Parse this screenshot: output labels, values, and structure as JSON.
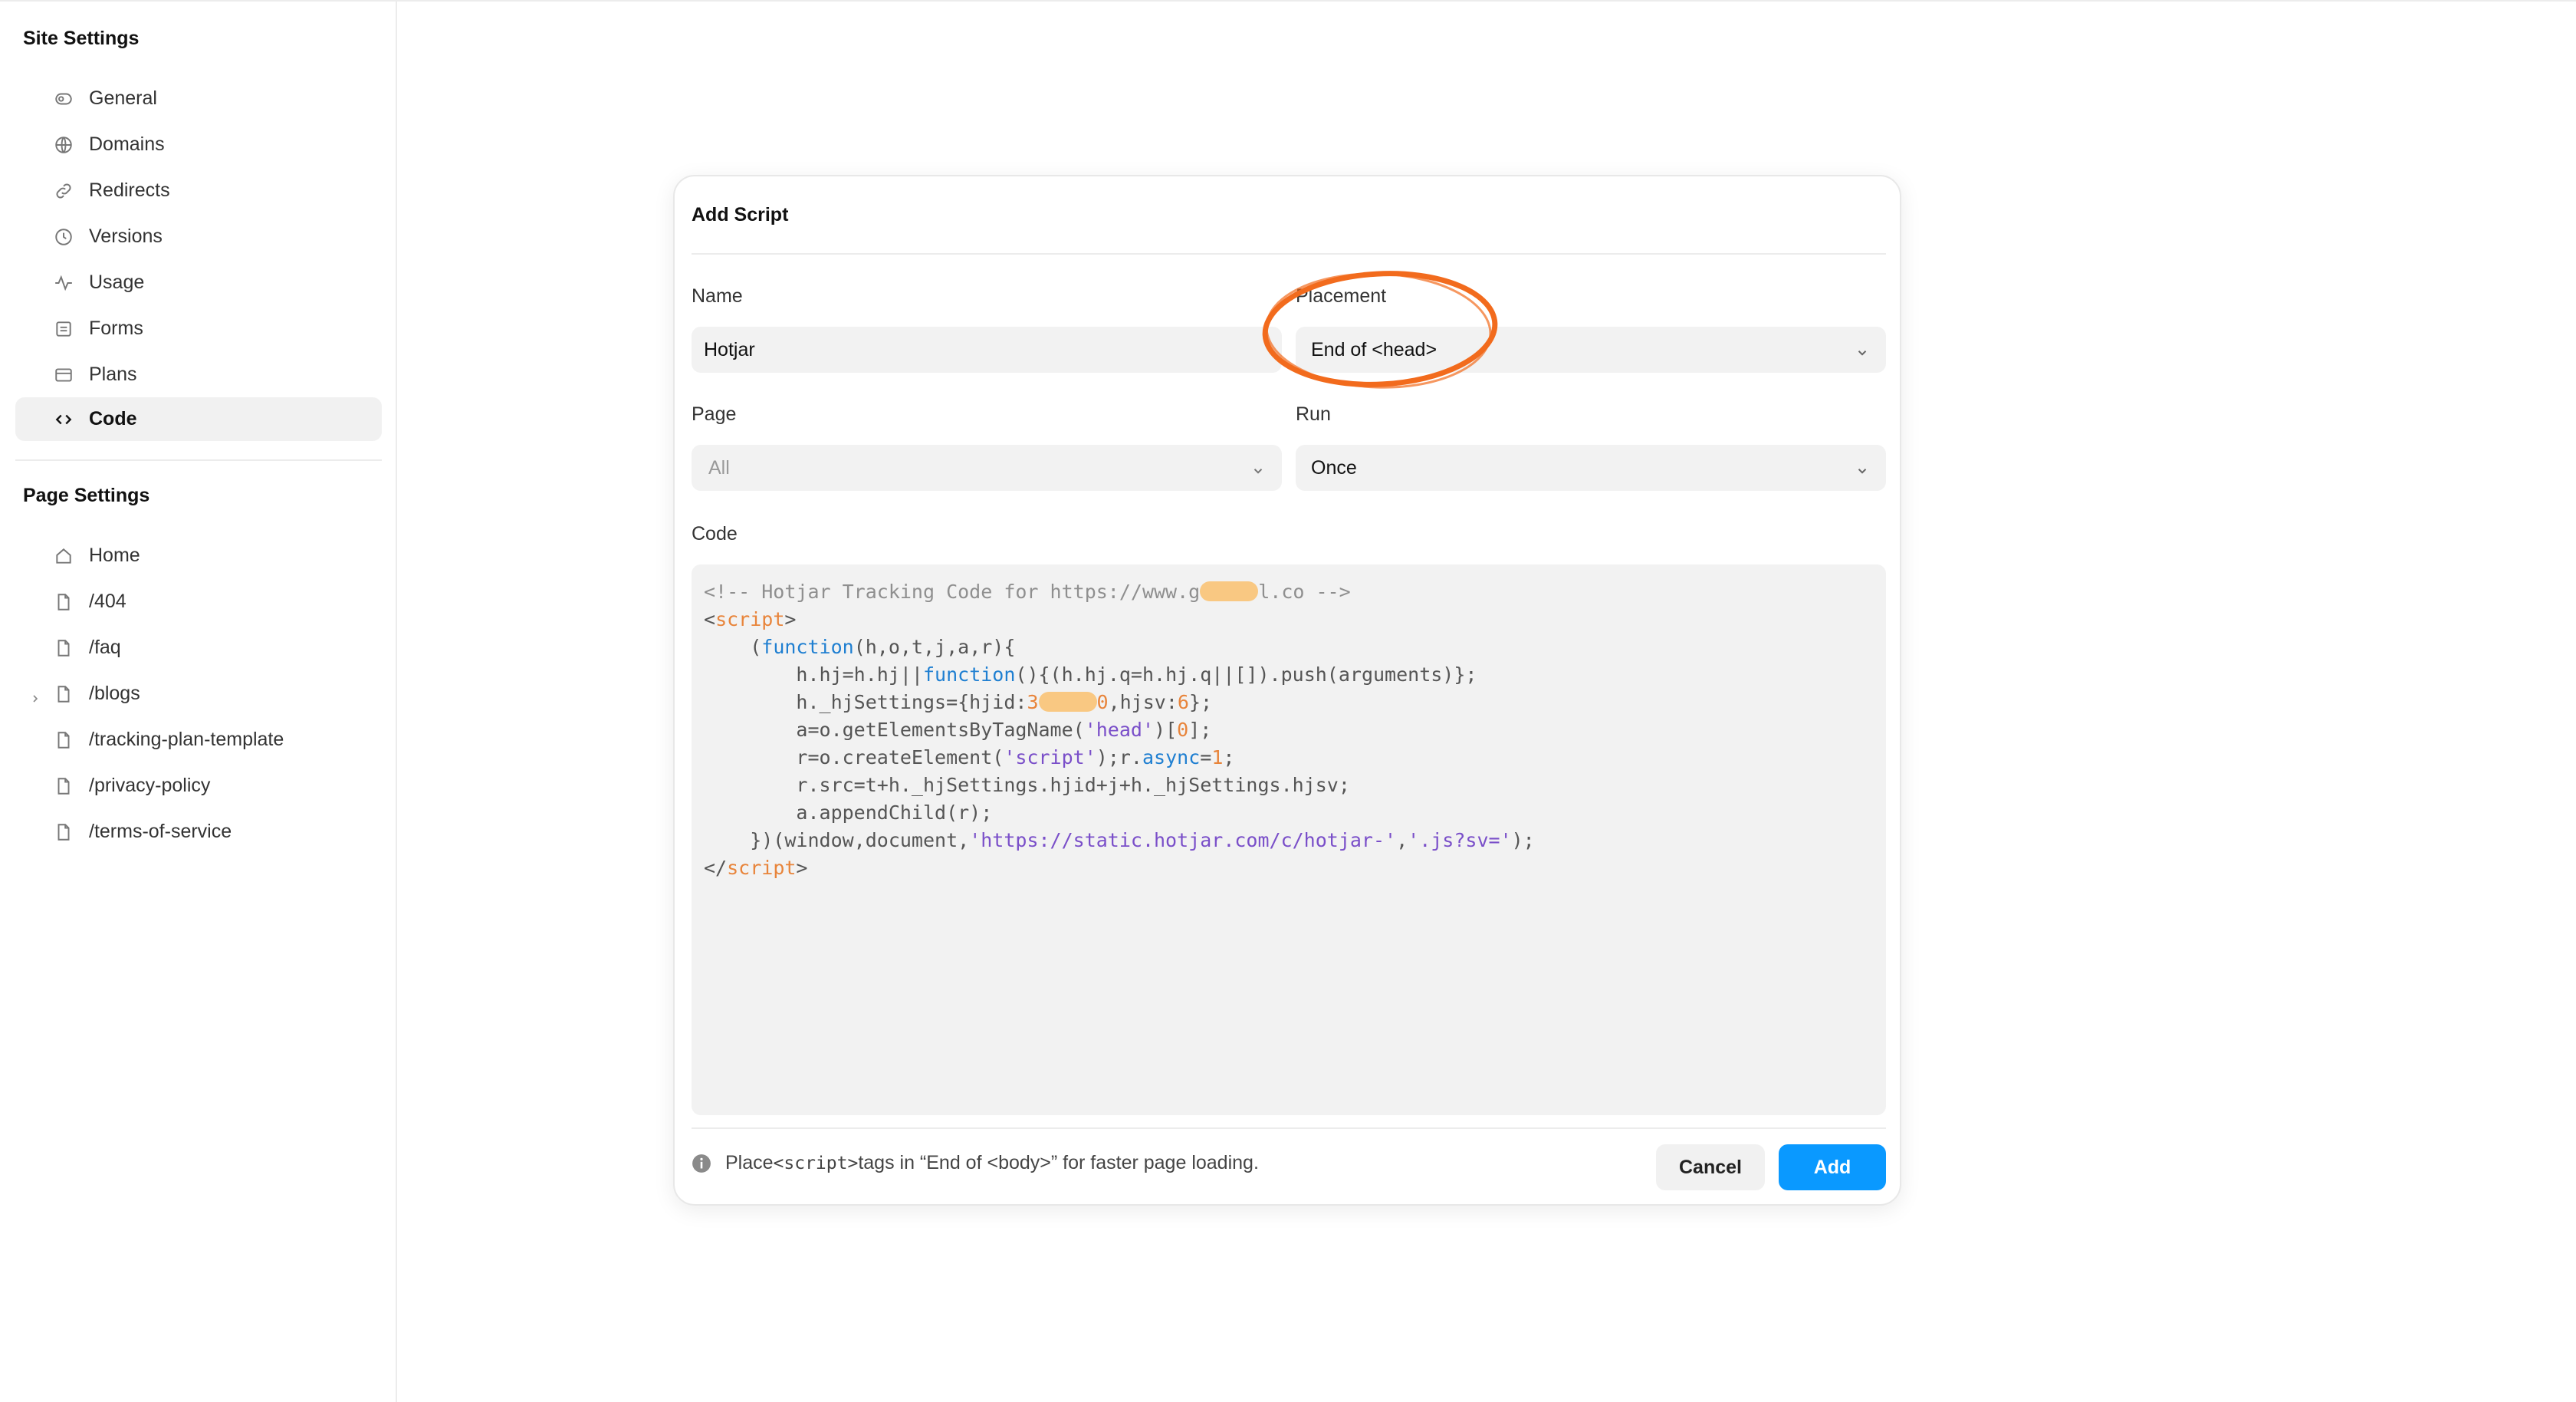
{
  "sidebar": {
    "site_settings_title": "Site Settings",
    "site_items": [
      {
        "label": "General",
        "icon": "toggle-icon"
      },
      {
        "label": "Domains",
        "icon": "globe-icon"
      },
      {
        "label": "Redirects",
        "icon": "link-icon"
      },
      {
        "label": "Versions",
        "icon": "clock-icon"
      },
      {
        "label": "Usage",
        "icon": "activity-icon"
      },
      {
        "label": "Forms",
        "icon": "form-icon"
      },
      {
        "label": "Plans",
        "icon": "card-icon"
      },
      {
        "label": "Code",
        "icon": "code-icon",
        "active": true
      }
    ],
    "page_settings_title": "Page Settings",
    "page_items": [
      {
        "label": "Home",
        "icon": "home-icon"
      },
      {
        "label": "/404",
        "icon": "page-icon"
      },
      {
        "label": "/faq",
        "icon": "page-icon"
      },
      {
        "label": "/blogs",
        "icon": "page-icon",
        "expandable": true
      },
      {
        "label": "/tracking-plan-template",
        "icon": "page-icon"
      },
      {
        "label": "/privacy-policy",
        "icon": "page-icon"
      },
      {
        "label": "/terms-of-service",
        "icon": "page-icon"
      }
    ]
  },
  "modal": {
    "title": "Add Script",
    "name_label": "Name",
    "name_value": "Hotjar",
    "placement_label": "Placement",
    "placement_value": "End of <head>",
    "page_label": "Page",
    "page_value": "All",
    "run_label": "Run",
    "run_value": "Once",
    "code_label": "Code",
    "code": {
      "l1a": "<!-- Hotjar Tracking Code for https://www.g",
      "l1b": "l.co -->",
      "l2a": "<",
      "l2b": "script",
      "l2c": ">",
      "l3a": "    (",
      "l3b": "function",
      "l3c": "(h,o,t,j,a,r){",
      "l4a": "        h.hj=h.hj||",
      "l4b": "function",
      "l4c": "(){(h.hj.q=h.hj.q||[]).push(arguments)};",
      "l5a": "        h._hjSettings={hjid:",
      "l5b": "3",
      "l5c": "0",
      "l5d": ",hjsv:",
      "l5e": "6",
      "l5f": "};",
      "l6a": "        a=o.getElementsByTagName(",
      "l6b": "'head'",
      "l6c": ")[",
      "l6d": "0",
      "l6e": "];",
      "l7a": "        r=o.createElement(",
      "l7b": "'script'",
      "l7c": ");r.",
      "l7d": "async",
      "l7e": "=",
      "l7f": "1",
      "l7g": ";",
      "l8": "        r.src=t+h._hjSettings.hjid+j+h._hjSettings.hjsv;",
      "l9": "        a.appendChild(r);",
      "l10a": "    })(window,document,",
      "l10b": "'https://static.hotjar.com/c/hotjar-'",
      "l10c": ",",
      "l10d": "'.js?sv='",
      "l10e": ");",
      "l11a": "</",
      "l11b": "script",
      "l11c": ">"
    },
    "hint_prefix": "Place ",
    "hint_code": "<script>",
    "hint_suffix": " tags in “End of <body>” for faster page loading.",
    "cancel_label": "Cancel",
    "add_label": "Add"
  },
  "colors": {
    "accent": "#0a99ff",
    "annotation": "#f26b1d",
    "redaction": "#f9c882"
  }
}
